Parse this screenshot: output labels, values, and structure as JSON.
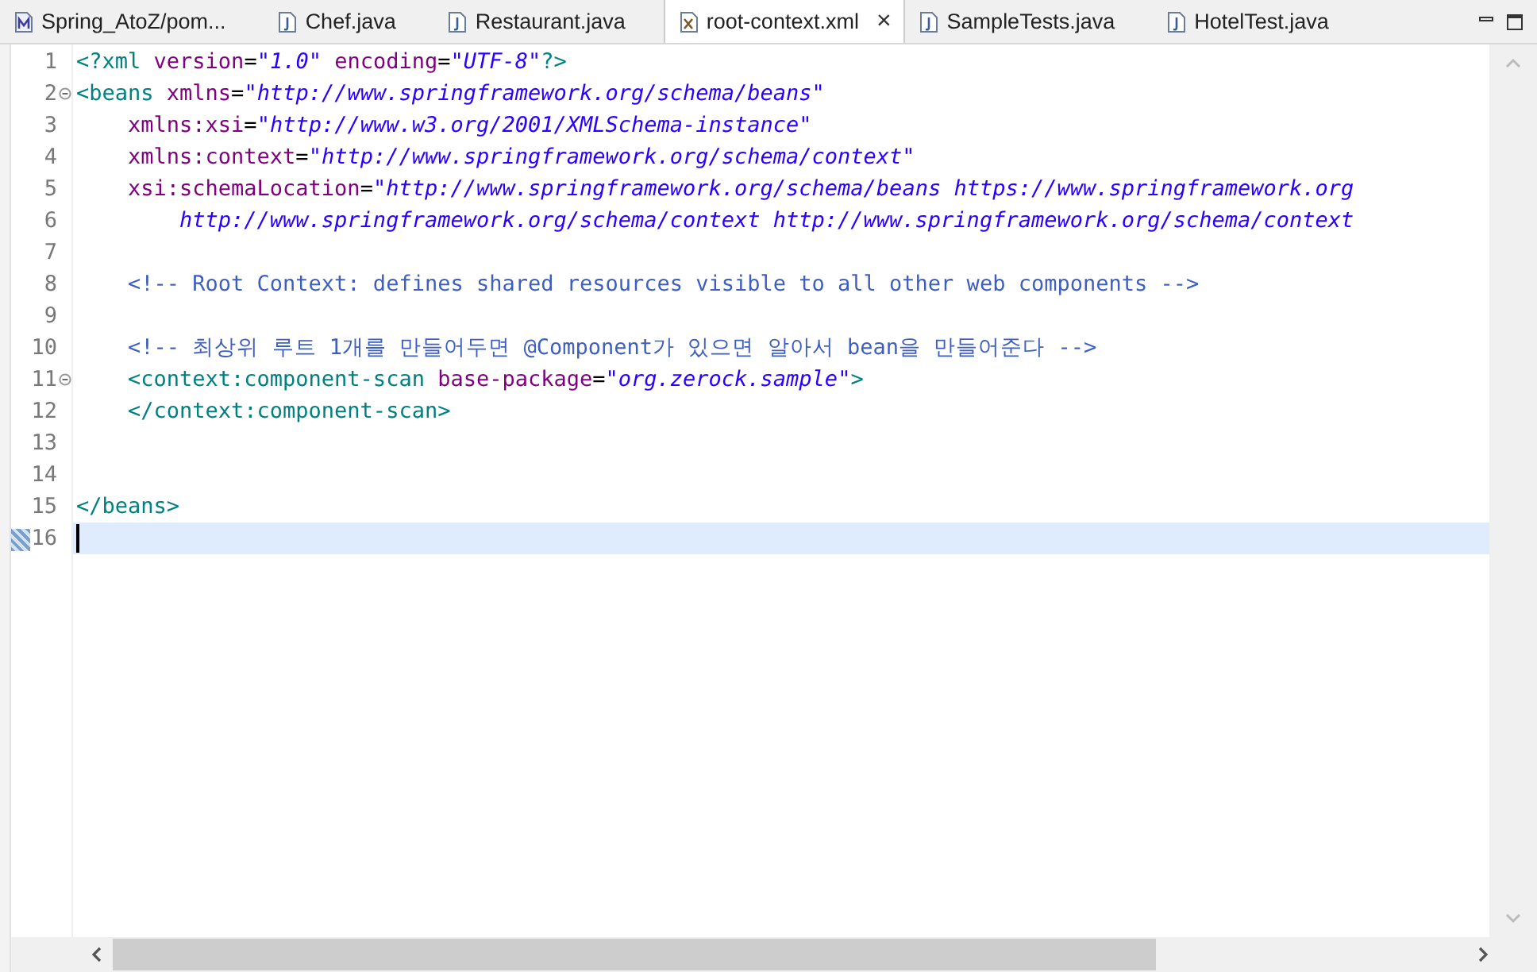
{
  "tabs": [
    {
      "label": "Spring_AtoZ/pom...",
      "kind": "maven",
      "selected": false,
      "closable": false
    },
    {
      "label": "Chef.java",
      "kind": "java",
      "selected": false,
      "closable": false
    },
    {
      "label": "Restaurant.java",
      "kind": "java",
      "selected": false,
      "closable": false
    },
    {
      "label": "root-context.xml",
      "kind": "xml",
      "selected": true,
      "closable": true,
      "close": "×"
    },
    {
      "label": "SampleTests.java",
      "kind": "java",
      "selected": false,
      "closable": false
    },
    {
      "label": "HotelTest.java",
      "kind": "java",
      "selected": false,
      "closable": false
    }
  ],
  "editor": {
    "lines": [
      {
        "number": "1",
        "fold": false,
        "current": false,
        "tokens": [
          {
            "kind": "tag",
            "text": "<?xml "
          },
          {
            "kind": "attr",
            "text": "version"
          },
          {
            "kind": "plain",
            "text": "="
          },
          {
            "kind": "string",
            "text": "\"1.0\""
          },
          {
            "kind": "attr",
            "text": " encoding"
          },
          {
            "kind": "plain",
            "text": "="
          },
          {
            "kind": "string",
            "text": "\"UTF-8\""
          },
          {
            "kind": "tag",
            "text": "?>"
          }
        ]
      },
      {
        "number": "2",
        "fold": true,
        "current": false,
        "tokens": [
          {
            "kind": "tag",
            "text": "<beans "
          },
          {
            "kind": "attr",
            "text": "xmlns"
          },
          {
            "kind": "plain",
            "text": "="
          },
          {
            "kind": "string",
            "text": "\"http://www.springframework.org/schema/beans\""
          }
        ]
      },
      {
        "number": "3",
        "fold": false,
        "current": false,
        "tokens": [
          {
            "kind": "attr",
            "text": "    xmlns:xsi"
          },
          {
            "kind": "plain",
            "text": "="
          },
          {
            "kind": "string",
            "text": "\"http://www.w3.org/2001/XMLSchema-instance\""
          }
        ]
      },
      {
        "number": "4",
        "fold": false,
        "current": false,
        "tokens": [
          {
            "kind": "attr",
            "text": "    xmlns:context"
          },
          {
            "kind": "plain",
            "text": "="
          },
          {
            "kind": "string",
            "text": "\"http://www.springframework.org/schema/context\""
          }
        ]
      },
      {
        "number": "5",
        "fold": false,
        "current": false,
        "tokens": [
          {
            "kind": "attr",
            "text": "    xsi:schemaLocation"
          },
          {
            "kind": "plain",
            "text": "="
          },
          {
            "kind": "string",
            "text": "\"http://www.springframework.org/schema/beans https://www.springframework.org"
          }
        ]
      },
      {
        "number": "6",
        "fold": false,
        "current": false,
        "tokens": [
          {
            "kind": "string",
            "text": "        http://www.springframework.org/schema/context http://www.springframework.org/schema/context"
          }
        ]
      },
      {
        "number": "7",
        "fold": false,
        "current": false
      },
      {
        "number": "8",
        "fold": false,
        "current": false,
        "tokens": [
          {
            "kind": "comment",
            "text": "    <!-- Root Context: defines shared resources visible to all other web components -->"
          }
        ]
      },
      {
        "number": "9",
        "fold": false,
        "current": false
      },
      {
        "number": "10",
        "fold": false,
        "current": false,
        "tokens": [
          {
            "kind": "comment",
            "text": "    <!-- 최상위 루트 1개를 만들어두면 @Component가 있으면 알아서 bean을 만들어준다 -->"
          }
        ]
      },
      {
        "number": "11",
        "fold": true,
        "current": false,
        "tokens": [
          {
            "kind": "tag",
            "text": "    <context:component-scan "
          },
          {
            "kind": "attr",
            "text": "base-package"
          },
          {
            "kind": "plain",
            "text": "="
          },
          {
            "kind": "string",
            "text": "\"org.zerock.sample\""
          },
          {
            "kind": "tag",
            "text": ">"
          }
        ]
      },
      {
        "number": "12",
        "fold": false,
        "current": false,
        "tokens": [
          {
            "kind": "tag",
            "text": "    </context:component-scan>"
          }
        ]
      },
      {
        "number": "13",
        "fold": false,
        "current": false
      },
      {
        "number": "14",
        "fold": false,
        "current": false
      },
      {
        "number": "15",
        "fold": false,
        "current": false,
        "tokens": [
          {
            "kind": "tag",
            "text": "</beans>"
          }
        ]
      },
      {
        "number": "16",
        "fold": false,
        "current": true
      }
    ]
  }
}
